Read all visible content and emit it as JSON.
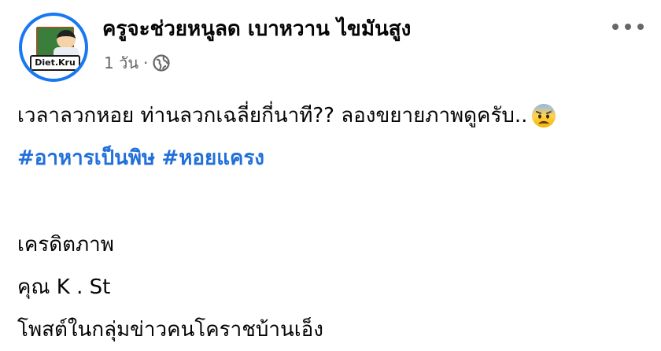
{
  "post": {
    "page_name": "ครูจะช่วยหนูลด เบาหวาน ไขมันสูง",
    "time": "1 วัน",
    "separator": "·",
    "avatar_text": "Diet.Kru",
    "privacy_icon": "globe-icon",
    "more_icon": "more-options-icon",
    "text_line1": "เวลาลวกหอย ท่านลวกเฉลี่ยกี่นาที?? ลองขยายภาพดูครับ..",
    "emoji_icon": "anxious-face-icon",
    "hashtags": [
      "#อาหารเป็นพิษ",
      "#หอยแครง"
    ],
    "credit_title": "เครดิตภาพ",
    "credit_name": "คุณ K . St",
    "credit_source": "โพสต์ในกลุ่มข่าวคนโคราชบ้านเอ็ง"
  },
  "colors": {
    "accent": "#1877f2",
    "hashtag": "#216fdb",
    "secondary_text": "#65676b"
  }
}
